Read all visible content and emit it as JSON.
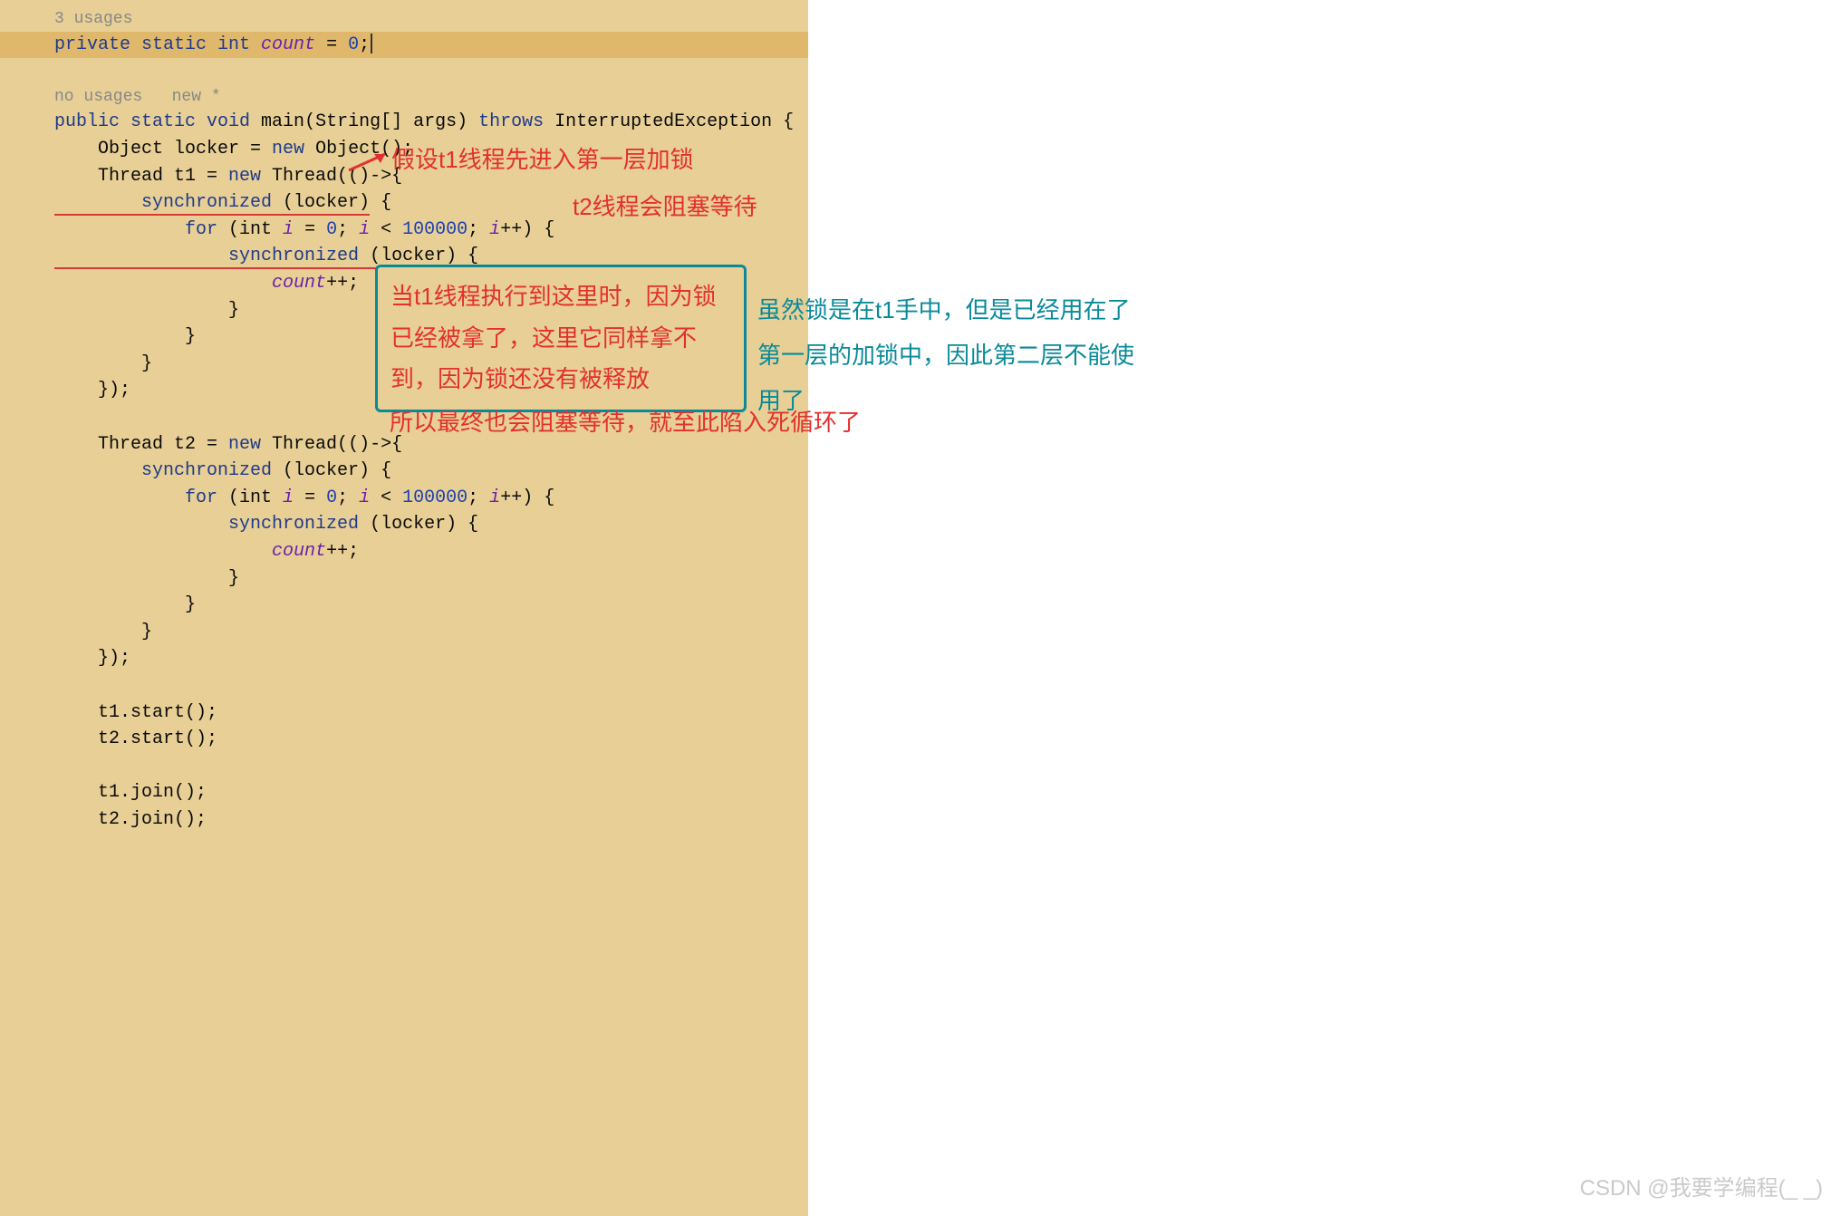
{
  "hints": {
    "usages_top": "3 usages",
    "usages_main": "no usages   new *"
  },
  "code": {
    "l1_priv": "private static int ",
    "l1_count": "count",
    "l1_rest": " = ",
    "l1_zero": "0",
    "l1_end": ";",
    "l3_pub": "public static void ",
    "l3_main": "main",
    "l3_args": "(String[] args) ",
    "l3_throws": "throws",
    "l3_exc": " InterruptedException {",
    "l4": "    Object locker = ",
    "l4_new": "new",
    "l4_rest": " Object();",
    "l5": "    Thread t1 = ",
    "l5_new": "new",
    "l5_rest": " Thread(()->{",
    "l6_sync": "        synchronized ",
    "l6_lock": "(locker)",
    "l6_brace": " {",
    "l7_for": "            for ",
    "l7_int": "(int ",
    "l7_i1": "i",
    "l7_eq": " = ",
    "l7_zero": "0",
    "l7_sc": "; ",
    "l7_i2": "i",
    "l7_lt": " < ",
    "l7_lim": "100000",
    "l7_sc2": "; ",
    "l7_i3": "i",
    "l7_pp": "++) {",
    "l8_sync": "                synchronized ",
    "l8_lock": "(locker)",
    "l8_brace": " {",
    "l9_sp": "                    ",
    "l9_count": "count",
    "l9_pp": "++;",
    "l10": "                }",
    "l11": "            }",
    "l12": "        }",
    "l13": "    });",
    "l15": "    Thread t2 = ",
    "l15_new": "new",
    "l15_rest": " Thread(()->{",
    "l16": "        synchronized (locker) {",
    "l17_for": "            for ",
    "l17_int": "(int ",
    "l17_i1": "i",
    "l17_eq": " = ",
    "l17_zero": "0",
    "l17_sc": "; ",
    "l17_i2": "i",
    "l17_lt": " < ",
    "l17_lim": "100000",
    "l17_sc2": "; ",
    "l17_i3": "i",
    "l17_pp": "++) {",
    "l18": "                synchronized (locker) {",
    "l19_sp": "                    ",
    "l19_count": "count",
    "l19_pp": "++;",
    "l20": "                }",
    "l21": "            }",
    "l22": "        }",
    "l23": "    });",
    "l25": "    t1.start();",
    "l26": "    t2.start();",
    "l28": "    t1.join();",
    "l29": "    t2.join();"
  },
  "annotations": {
    "a1": "假设t1线程先进入第一层加锁",
    "a2": "t2线程会阻塞等待",
    "box1": "当t1线程执行到这里时，因为锁已经被拿了，这里它同样拿不到，因为锁还没有被释放",
    "teal1": "虽然锁是在t1手中，但是已经用在了",
    "teal2": "第一层的加锁中，因此第二层不能使",
    "teal3": "用了",
    "a3": "所以最终也会阻塞等待，就至此陷入死循环了"
  },
  "watermark": "CSDN @我要学编程(_ _)"
}
